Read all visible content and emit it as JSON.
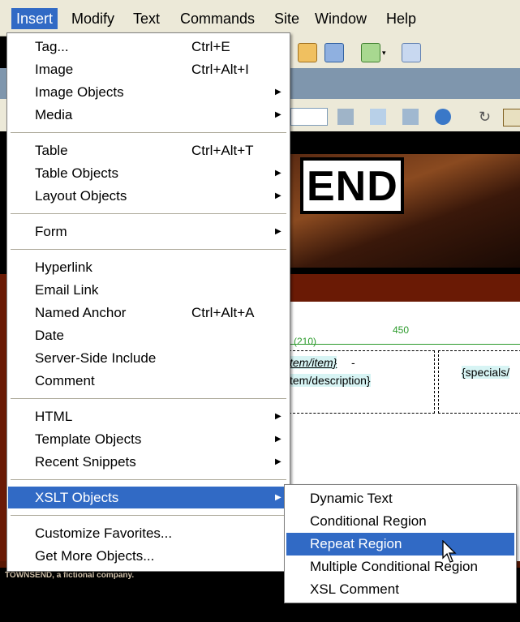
{
  "menubar": [
    "Insert",
    "Modify",
    "Text",
    "Commands",
    "Site",
    "Window",
    "Help"
  ],
  "insert_menu": {
    "groups": [
      [
        {
          "label": "Tag...",
          "shortcut": "Ctrl+E",
          "submenu": false
        },
        {
          "label": "Image",
          "shortcut": "Ctrl+Alt+I",
          "submenu": false
        },
        {
          "label": "Image Objects",
          "shortcut": "",
          "submenu": true
        },
        {
          "label": "Media",
          "shortcut": "",
          "submenu": true
        }
      ],
      [
        {
          "label": "Table",
          "shortcut": "Ctrl+Alt+T",
          "submenu": false
        },
        {
          "label": "Table Objects",
          "shortcut": "",
          "submenu": true
        },
        {
          "label": "Layout Objects",
          "shortcut": "",
          "submenu": true
        }
      ],
      [
        {
          "label": "Form",
          "shortcut": "",
          "submenu": true
        }
      ],
      [
        {
          "label": "Hyperlink",
          "shortcut": "",
          "submenu": false
        },
        {
          "label": "Email Link",
          "shortcut": "",
          "submenu": false
        },
        {
          "label": "Named Anchor",
          "shortcut": "Ctrl+Alt+A",
          "submenu": false
        },
        {
          "label": "Date",
          "shortcut": "",
          "submenu": false
        },
        {
          "label": "Server-Side Include",
          "shortcut": "",
          "submenu": false
        },
        {
          "label": "Comment",
          "shortcut": "",
          "submenu": false
        }
      ],
      [
        {
          "label": "HTML",
          "shortcut": "",
          "submenu": true
        },
        {
          "label": "Template Objects",
          "shortcut": "",
          "submenu": true
        },
        {
          "label": "Recent Snippets",
          "shortcut": "",
          "submenu": true
        }
      ],
      [
        {
          "label": "XSLT Objects",
          "shortcut": "",
          "submenu": true,
          "highlighted": true
        }
      ],
      [
        {
          "label": "Customize Favorites...",
          "shortcut": "",
          "submenu": false
        },
        {
          "label": "Get More Objects...",
          "shortcut": "",
          "submenu": false
        }
      ]
    ]
  },
  "xslt_submenu": [
    {
      "label": "Dynamic Text",
      "highlighted": false
    },
    {
      "label": "Conditional Region",
      "highlighted": false
    },
    {
      "label": "Repeat Region",
      "highlighted": true
    },
    {
      "label": "Multiple Conditional Region",
      "highlighted": false
    },
    {
      "label": "XSL Comment",
      "highlighted": false
    }
  ],
  "background": {
    "banner_text": "END",
    "ruler_left": "(210)",
    "ruler_mid": "450",
    "binding_line1": "tem/item}",
    "binding_sep": " -",
    "binding_line2": "tem/description}",
    "binding_cell2": "{specials/",
    "footer_text": "TOWNSEND, a fictional company."
  },
  "colors": {
    "highlight": "#316ac5",
    "menubar": "#ece9d8",
    "banner_red": "#6a1a05"
  }
}
